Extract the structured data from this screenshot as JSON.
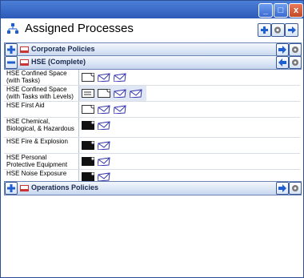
{
  "window": {
    "buttons": [
      "_",
      "□",
      "x"
    ]
  },
  "header": {
    "title": "Assigned Processes"
  },
  "groups": {
    "corporate": {
      "label": "Corporate Policies"
    },
    "hse": {
      "label": "HSE (Complete)"
    },
    "operations": {
      "label": "Operations Policies"
    }
  },
  "rows": [
    {
      "label": "HSE  Confined Space (with Tasks)"
    },
    {
      "label": "HSE  Confined Space (with Tasks with Levels)"
    },
    {
      "label": "HSE  First Aid"
    },
    {
      "label": "HSE  Chemical, Biological, & Hazardous"
    },
    {
      "label": "HSE  Fire & Explosion"
    },
    {
      "label": "HSE  Personal Protective Equipment"
    },
    {
      "label": "HSE  Noise Exposure"
    }
  ],
  "colors": {
    "titlebar": "#2c5bb8",
    "group_bar": "#c6d6ee",
    "accent_blue": "#1f5fd0"
  }
}
